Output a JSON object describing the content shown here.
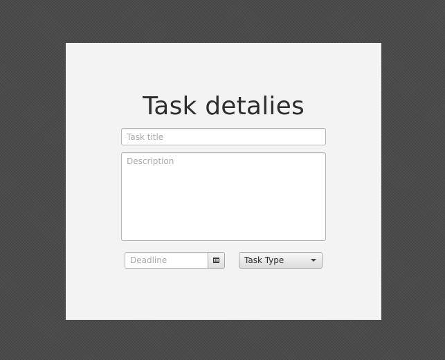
{
  "form": {
    "title": "Task detalies",
    "task_title_placeholder": "Task title",
    "description_placeholder": "Description",
    "deadline_placeholder": "Deadline",
    "task_type_label": "Task Type"
  },
  "icons": {
    "calendar": "calendar-icon",
    "dropdown": "chevron-down-icon"
  },
  "colors": {
    "background": "#4b4b4b",
    "panel": "#f3f3f3",
    "title_text": "#2e2e2e",
    "placeholder_text": "#a9a9a9"
  }
}
